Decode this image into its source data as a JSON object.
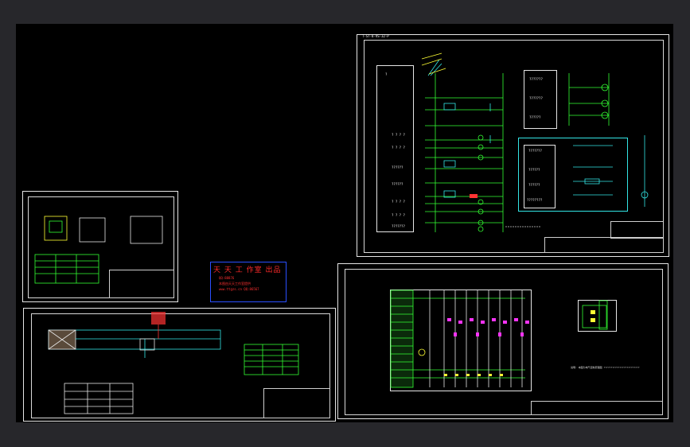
{
  "stamp": {
    "title": "天 天 工 作室 出品",
    "line1": "QQ:88876",
    "line2": "本图由天天工作室提供",
    "line3": "www.ttgzs.cn  QQ:86567"
  },
  "sheets": {
    "top_right_title": "T-ST-8-VS-32-P",
    "question_mark": "?",
    "labels_top_right": [
      "???????",
      "???????",
      "??????",
      "???????",
      "??????",
      "??????",
      "????????"
    ],
    "left_col_marks": [
      "? ? ? ?",
      "? ? ? ?",
      "??????",
      "??????",
      "? ? ? ?",
      "? ? ? ?",
      "???????"
    ],
    "bottom_note": "说明: 本图为电气控制原理图 ?????????????????????????"
  },
  "colors": {
    "background": "#000000",
    "frame": "#e6e6e6",
    "green": "#33ff33",
    "cyan": "#33e6e6",
    "yellow": "#ffff33",
    "magenta": "#ff33ff",
    "red": "#ff3333"
  }
}
